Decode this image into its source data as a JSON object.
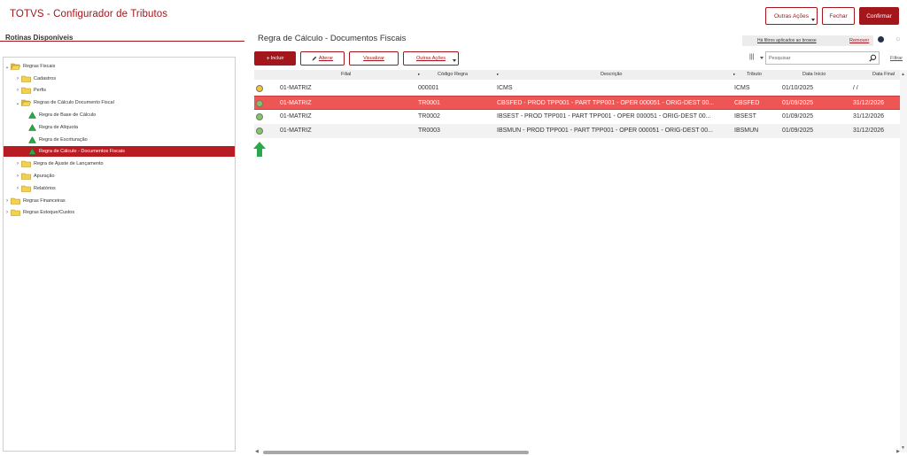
{
  "header": {
    "title": "TOTVS - Configurador de Tributos",
    "other_actions_label": "Outras Ações",
    "close_label": "Fechar",
    "confirm_label": "Confirmar"
  },
  "left_panel": {
    "title": "Rotinas Disponíveis",
    "tree": [
      {
        "label": "Regras Fiscais",
        "level": 0,
        "expanded": true,
        "icon": "folder-open-icon"
      },
      {
        "label": "Cadastros",
        "level": 1,
        "expanded": false,
        "icon": "folder-icon"
      },
      {
        "label": "Perfis",
        "level": 1,
        "expanded": false,
        "icon": "folder-icon"
      },
      {
        "label": "Regras de Cálculo Documento Fiscal",
        "level": 1,
        "expanded": true,
        "icon": "folder-open-icon"
      },
      {
        "label": "Regra de Base de Cálculo",
        "level": 2,
        "icon": "green-triangle-icon"
      },
      {
        "label": "Regra de Alíquota",
        "level": 2,
        "icon": "green-triangle-icon"
      },
      {
        "label": "Regra de Escrituração",
        "level": 2,
        "icon": "green-triangle-icon"
      },
      {
        "label": "Regra de Cálculo - Documentos Fiscais",
        "level": 2,
        "icon": "green-triangle-icon",
        "selected": true
      },
      {
        "label": "Regra de Ajuste de Lançamento",
        "level": 1,
        "expanded": false,
        "icon": "folder-icon"
      },
      {
        "label": "Apuração",
        "level": 1,
        "expanded": false,
        "icon": "folder-icon"
      },
      {
        "label": "Relatórios",
        "level": 1,
        "expanded": false,
        "icon": "folder-icon"
      },
      {
        "label": "Regras Financeiras",
        "level": 0,
        "expanded": false,
        "icon": "folder-icon"
      },
      {
        "label": "Regras Estoque/Custos",
        "level": 0,
        "expanded": false,
        "icon": "folder-icon"
      }
    ]
  },
  "main": {
    "title": "Regra de Cálculo - Documentos Fiscais",
    "filter_notice": "Há filtros aplicados ao browse",
    "remove_label": "Remover",
    "toolbar": {
      "include_label": "Incluir",
      "alter_label": "Alterar",
      "view_label": "Visualizar",
      "other_actions_label": "Outras Ações"
    },
    "search": {
      "placeholder": "Pesquisar",
      "value": ""
    },
    "filter_label": "Filtrar",
    "columns": [
      "Filial",
      "Código Regra",
      "Descrição",
      "Tributo",
      "Data Início",
      "Data Final"
    ],
    "rows": [
      {
        "status": "#f2c531",
        "filial": "01-MATRIZ",
        "codigo": "000001",
        "descricao": "ICMS",
        "tributo": "ICMS",
        "inicio": "01/10/2025",
        "final": "/ /"
      },
      {
        "status": "#7dc95e",
        "filial": "01-MATRIZ",
        "codigo": "TR0001",
        "descricao": "CBSFED - PROD TPP001 - PART TPP001 - OPER 000051 - ORIG-DEST 00...",
        "tributo": "CBSFED",
        "inicio": "01/09/2025",
        "final": "31/12/2026",
        "selected": true
      },
      {
        "status": "#7dc95e",
        "filial": "01-MATRIZ",
        "codigo": "TR0002",
        "descricao": "IBSEST - PROD TPP001 - PART TPP001 - OPER 000051 - ORIG-DEST 00...",
        "tributo": "IBSEST",
        "inicio": "01/09/2025",
        "final": "31/12/2026"
      },
      {
        "status": "#7dc95e",
        "filial": "01-MATRIZ",
        "codigo": "TR0003",
        "descricao": "IBSMUN - PROD TPP001 - PART TPP001 - OPER 000051 - ORIG-DEST 00...",
        "tributo": "IBSMUN",
        "inicio": "01/09/2025",
        "final": "31/12/2026"
      }
    ]
  },
  "colors": {
    "brand": "#a3161c",
    "selected_tree": "#b81c22",
    "selected_row": "#ee5555",
    "status_yellow": "#f2c531",
    "status_green": "#7dc95e",
    "arrow_green": "#2aa84a"
  }
}
